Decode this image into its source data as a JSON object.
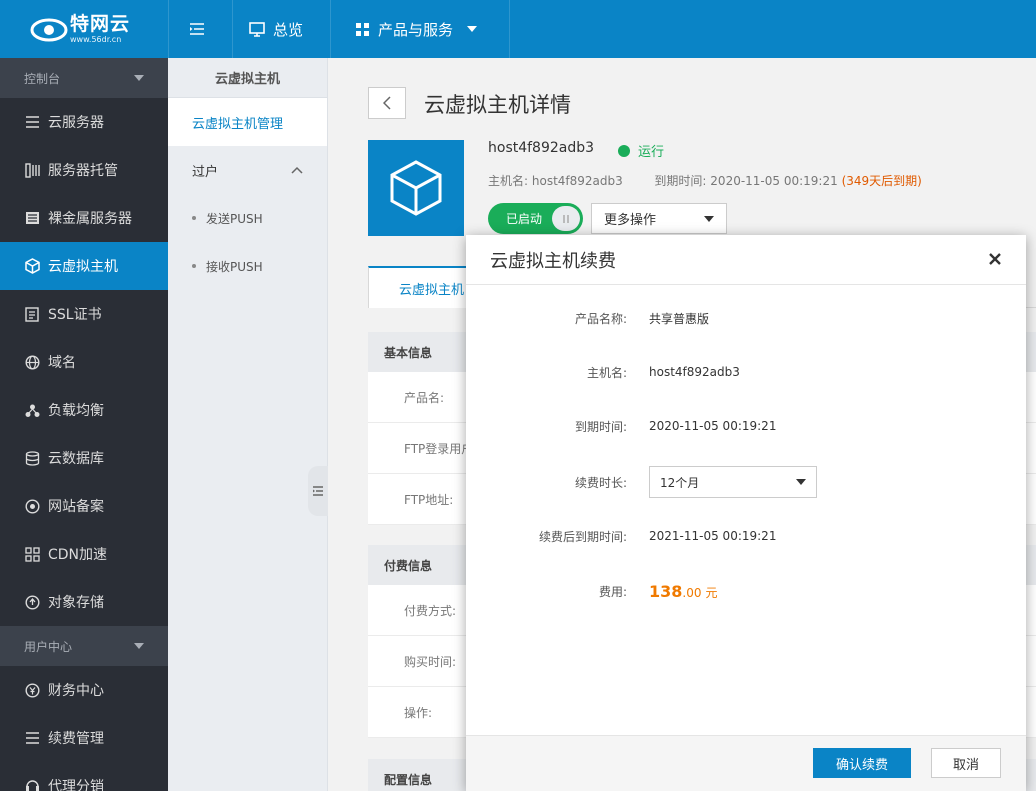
{
  "brand": {
    "title": "特网云",
    "url": "www.56dr.cn",
    "accent": "#0a84c6"
  },
  "topnav": {
    "overview": "总览",
    "products": "产品与服务"
  },
  "sidebar": {
    "group1": "控制台",
    "items": [
      {
        "label": "云服务器",
        "icon": "server-icon"
      },
      {
        "label": "服务器托管",
        "icon": "rack-icon"
      },
      {
        "label": "裸金属服务器",
        "icon": "baremetal-icon"
      },
      {
        "label": "云虚拟主机",
        "icon": "cube-icon"
      },
      {
        "label": "SSL证书",
        "icon": "certificate-icon"
      },
      {
        "label": "域名",
        "icon": "globe-icon"
      },
      {
        "label": "负载均衡",
        "icon": "balance-icon"
      },
      {
        "label": "云数据库",
        "icon": "database-icon"
      },
      {
        "label": "网站备案",
        "icon": "record-icon"
      },
      {
        "label": "CDN加速",
        "icon": "cdn-icon"
      },
      {
        "label": "对象存储",
        "icon": "storage-icon"
      }
    ],
    "group2": "用户中心",
    "items2": [
      {
        "label": "财务中心",
        "icon": "finance-icon"
      },
      {
        "label": "续费管理",
        "icon": "renew-icon"
      },
      {
        "label": "代理分销",
        "icon": "agent-icon"
      }
    ]
  },
  "subside": {
    "title": "云虚拟主机",
    "link": "云虚拟主机管理",
    "group": "过户",
    "subs": [
      "发送PUSH",
      "接收PUSH"
    ]
  },
  "main": {
    "title": "云虚拟主机详情",
    "host_name": "host4f892adb3",
    "status": "运行",
    "host_label": "主机名:",
    "host_value": "host4f892adb3",
    "expire_label": "到期时间:",
    "expire_value": "2020-11-05 00:19:21",
    "expire_warn": "(349天后到期)",
    "toggle": "已启动",
    "more": "更多操作",
    "tab": "云虚拟主机",
    "section_basic": "基本信息",
    "basic_rows": [
      "产品名:",
      "FTP登录用户",
      "FTP地址:"
    ],
    "section_pay": "付费信息",
    "pay_rows": [
      "付费方式:",
      "购买时间:",
      "操作:"
    ],
    "section_config": "配置信息"
  },
  "dialog": {
    "title": "云虚拟主机续费",
    "product_label": "产品名称:",
    "product_value": "共享普惠版",
    "host_label": "主机名:",
    "host_value": "host4f892adb3",
    "expire_label": "到期时间:",
    "expire_value": "2020-11-05 00:19:21",
    "duration_label": "续费时长:",
    "duration_value": "12个月",
    "new_expire_label": "续费后到期时间:",
    "new_expire_value": "2021-11-05 00:19:21",
    "fee_label": "费用:",
    "fee_int": "138",
    "fee_dec": ".00",
    "fee_unit": "元",
    "confirm": "确认续费",
    "cancel": "取消"
  }
}
